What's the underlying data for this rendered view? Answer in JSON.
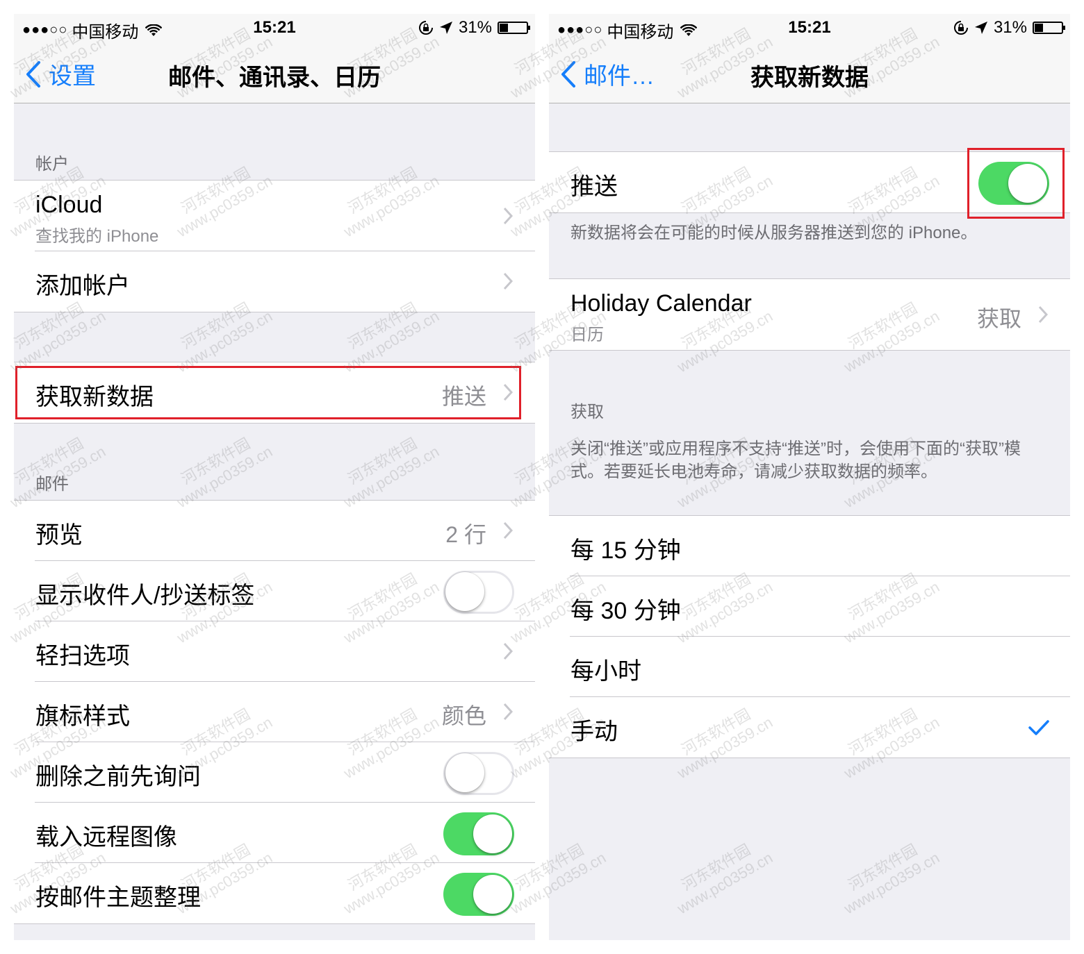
{
  "status_bar": {
    "signal": "●●●○○",
    "carrier": "中国移动",
    "time": "15:21",
    "battery_percent": "31%",
    "battery_level": 0.31
  },
  "left_screen": {
    "nav": {
      "back_label": "设置",
      "title": "邮件、通讯录、日历"
    },
    "accounts_header": "帐户",
    "icloud": {
      "label": "iCloud",
      "sublabel": "查找我的 iPhone"
    },
    "add_account": "添加帐户",
    "fetch_new_data": {
      "label": "获取新数据",
      "value": "推送"
    },
    "mail_header": "邮件",
    "mail_rows": {
      "preview": {
        "label": "预览",
        "value": "2 行"
      },
      "show_to_cc": {
        "label": "显示收件人/抄送标签",
        "toggle": false
      },
      "swipe_options": {
        "label": "轻扫选项"
      },
      "flag_style": {
        "label": "旗标样式",
        "value": "颜色"
      },
      "ask_before_delete": {
        "label": "删除之前先询问",
        "toggle": false
      },
      "load_remote_images": {
        "label": "载入远程图像",
        "toggle": true
      },
      "organize_by_thread": {
        "label": "按邮件主题整理",
        "toggle": true
      }
    }
  },
  "right_screen": {
    "nav": {
      "back_label": "邮件…",
      "title": "获取新数据"
    },
    "push": {
      "label": "推送",
      "toggle": true
    },
    "push_footer": "新数据将会在可能的时候从服务器推送到您的 iPhone。",
    "holiday_calendar": {
      "label": "Holiday Calendar",
      "sublabel": "日历",
      "value": "获取"
    },
    "fetch_header": "获取",
    "fetch_description": "关闭“推送”或应用程序不支持“推送”时，会使用下面的“获取”模式。若要延长电池寿命，请减少获取数据的频率。",
    "fetch_options": [
      "每 15 分钟",
      "每 30 分钟",
      "每小时",
      "手动"
    ],
    "selected_option": "手动"
  },
  "watermark": {
    "line1": "河东软件园",
    "line2": "www.pc0359.cn"
  },
  "colors": {
    "accent": "#157efb",
    "toggle_on": "#4cd964",
    "highlight": "#e0202a"
  }
}
